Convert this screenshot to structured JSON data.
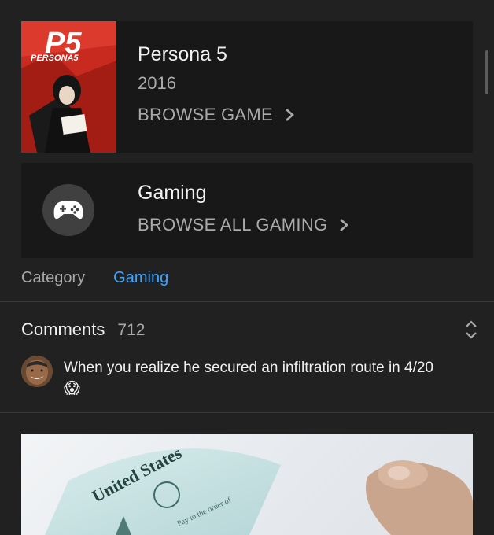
{
  "game": {
    "cover_logo_text": "PERSONA5",
    "title": "Persona 5",
    "year": "2016",
    "browse_label": "BROWSE GAME"
  },
  "category_card": {
    "icon": "gamepad-icon",
    "title": "Gaming",
    "browse_label": "BROWSE ALL GAMING"
  },
  "category_row": {
    "label": "Category",
    "value": "Gaming"
  },
  "comments": {
    "label": "Comments",
    "count": "712",
    "top_comment": {
      "text": "When you realize he secured an infiltration route in 4/20",
      "emoji": "😱"
    }
  },
  "thumbnail_photo": {
    "check_text": "United States",
    "check_line": "Pay to the order of"
  },
  "colors": {
    "background": "#212121",
    "card": "#181818",
    "accent_link": "#3ea6ff",
    "secondary_text": "#aaaaaa"
  }
}
